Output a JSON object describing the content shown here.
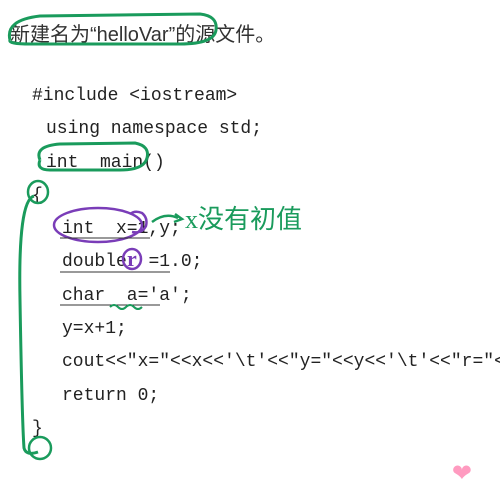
{
  "title": {
    "prefix": "新建名为",
    "open_quote": "“",
    "filename": "helloVar",
    "close_quote": "”",
    "suffix": "的源文件。"
  },
  "code": {
    "line1": "#include <iostream>",
    "line2": "using namespace std;",
    "line3": "int  main()",
    "line4": "{",
    "line5a": "int  x=1",
    "line5b": "y;",
    "line6a": "double ",
    "line6b": "=1.0;",
    "line7": "char  a='a';",
    "line8": "y=x+1;",
    "line9": "cout<<\"x=\"<<x<<'\\t'<<\"y=\"<<y<<'\\t'<<\"r=\"<<r<<",
    "line10": "return 0;",
    "line11": "}"
  },
  "annotations": {
    "note1": "x没有初值",
    "var_r": "r"
  }
}
